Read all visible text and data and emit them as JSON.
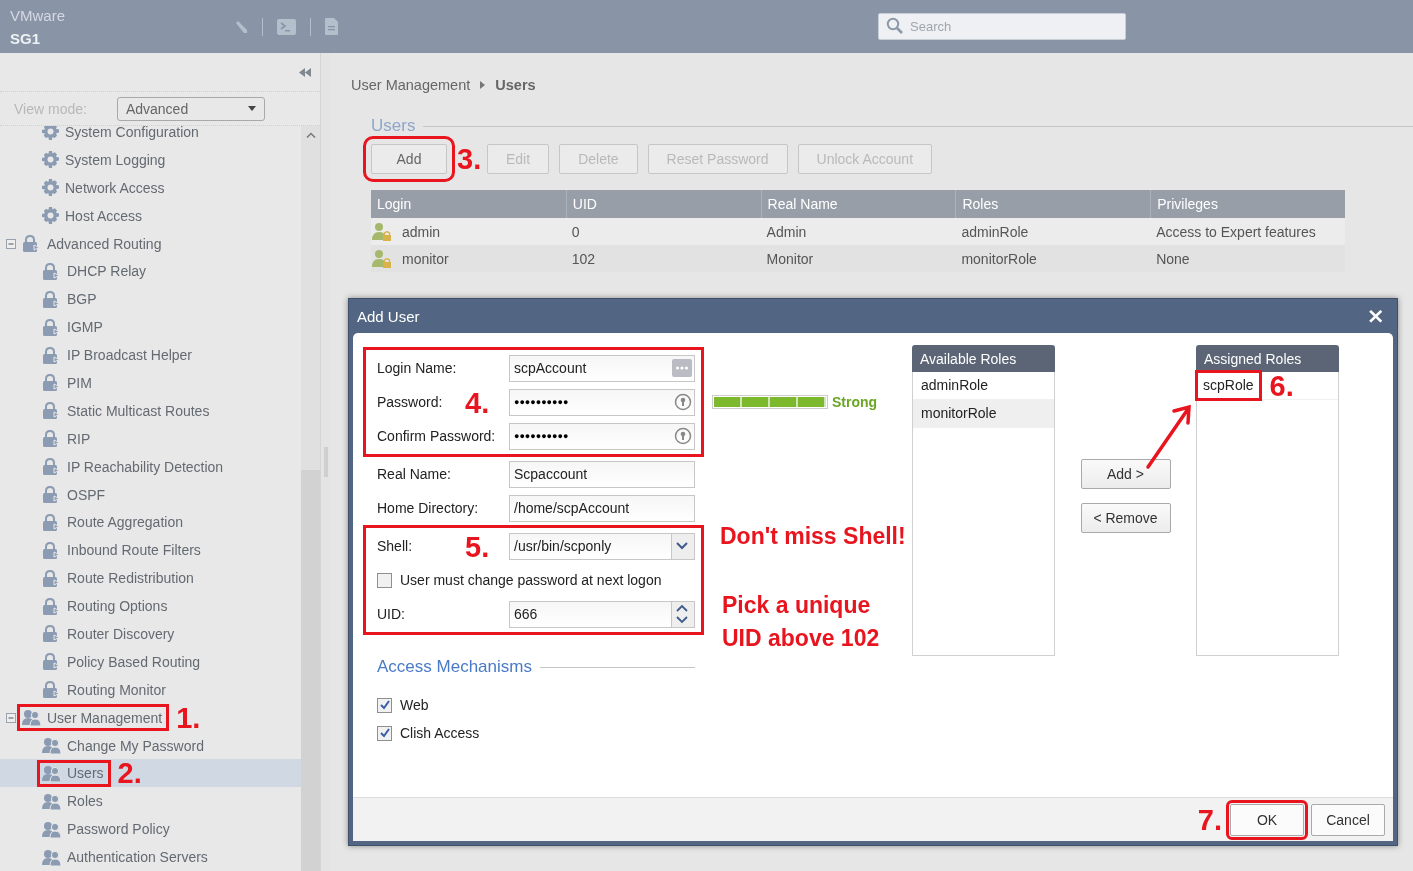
{
  "topbar": {
    "brand": "VMware",
    "host": "SG1",
    "search": {
      "placeholder": "Search"
    }
  },
  "sidebar": {
    "view_mode_label": "View mode:",
    "view_mode": "Advanced",
    "tree": [
      {
        "children": [
          {
            "label": "System Configuration",
            "kind": "gear",
            "selected": false,
            "highlighted": false
          },
          {
            "label": "System Logging",
            "kind": "gear",
            "selected": false,
            "highlighted": false
          },
          {
            "label": "Network Access",
            "kind": "gear",
            "selected": false,
            "highlighted": false
          },
          {
            "label": "Host Access",
            "kind": "gear",
            "selected": false,
            "highlighted": false
          }
        ]
      },
      {
        "label": "Advanced Routing",
        "kind": "routing",
        "expanded": true,
        "selected": false,
        "highlighted": false,
        "children": [
          {
            "label": "DHCP Relay",
            "kind": "routing",
            "selected": false,
            "highlighted": false
          },
          {
            "label": "BGP",
            "kind": "routing",
            "selected": false,
            "highlighted": false
          },
          {
            "label": "IGMP",
            "kind": "routing",
            "selected": false,
            "highlighted": false
          },
          {
            "label": "IP Broadcast Helper",
            "kind": "routing",
            "selected": false,
            "highlighted": false
          },
          {
            "label": "PIM",
            "kind": "routing",
            "selected": false,
            "highlighted": false
          },
          {
            "label": "Static Multicast Routes",
            "kind": "routing",
            "selected": false,
            "highlighted": false
          },
          {
            "label": "RIP",
            "kind": "routing",
            "selected": false,
            "highlighted": false
          },
          {
            "label": "IP Reachability Detection",
            "kind": "routing",
            "selected": false,
            "highlighted": false
          },
          {
            "label": "OSPF",
            "kind": "routing",
            "selected": false,
            "highlighted": false
          },
          {
            "label": "Route Aggregation",
            "kind": "routing",
            "selected": false,
            "highlighted": false
          },
          {
            "label": "Inbound Route Filters",
            "kind": "routing",
            "selected": false,
            "highlighted": false
          },
          {
            "label": "Route Redistribution",
            "kind": "routing",
            "selected": false,
            "highlighted": false
          },
          {
            "label": "Routing Options",
            "kind": "routing",
            "selected": false,
            "highlighted": false
          },
          {
            "label": "Router Discovery",
            "kind": "routing",
            "selected": false,
            "highlighted": false
          },
          {
            "label": "Policy Based Routing",
            "kind": "routing",
            "selected": false,
            "highlighted": false
          },
          {
            "label": "Routing Monitor",
            "kind": "routing",
            "selected": false,
            "highlighted": false
          }
        ]
      },
      {
        "label": "User Management",
        "kind": "user",
        "expanded": true,
        "selected": false,
        "highlighted": true,
        "step": "1.",
        "children": [
          {
            "label": "Change My Password",
            "kind": "user",
            "selected": false,
            "highlighted": false
          },
          {
            "label": "Users",
            "kind": "user",
            "selected": true,
            "highlighted": true,
            "step": "2."
          },
          {
            "label": "Roles",
            "kind": "user",
            "selected": false,
            "highlighted": false
          },
          {
            "label": "Password Policy",
            "kind": "user",
            "selected": false,
            "highlighted": false
          },
          {
            "label": "Authentication Servers",
            "kind": "user",
            "selected": false,
            "highlighted": false
          }
        ]
      }
    ]
  },
  "breadcrumb": [
    "User Management",
    "Users"
  ],
  "section_title": "Users",
  "toolbar": [
    {
      "label": "Add",
      "disabled": false,
      "highlighted": true,
      "step": "3."
    },
    {
      "label": "Edit",
      "disabled": true,
      "highlighted": false
    },
    {
      "label": "Delete",
      "disabled": true,
      "highlighted": false
    },
    {
      "label": "Reset Password",
      "disabled": true,
      "highlighted": false
    },
    {
      "label": "Unlock Account",
      "disabled": true,
      "highlighted": false
    }
  ],
  "table": {
    "columns": [
      "Login",
      "UID",
      "Real Name",
      "Roles",
      "Privileges"
    ],
    "rows": [
      {
        "login": "admin",
        "uid": "0",
        "real_name": "Admin",
        "roles": "adminRole",
        "privileges": "Access to Expert features"
      },
      {
        "login": "monitor",
        "uid": "102",
        "real_name": "Monitor",
        "roles": "monitorRole",
        "privileges": "None"
      }
    ]
  },
  "dialog": {
    "title": "Add User",
    "close": "×",
    "groups": [
      {
        "highlighted": true,
        "fields": [
          {
            "label": "Login Name:",
            "kind": "text-button",
            "value": "scpAccount"
          },
          {
            "label": "Password:",
            "kind": "password",
            "value": "●●●●●●●●●●",
            "step": "4.",
            "meter": {
              "level": 1,
              "label": "Strong"
            }
          },
          {
            "label": "Confirm Password:",
            "kind": "password",
            "value": "●●●●●●●●●●"
          }
        ]
      },
      {
        "highlighted": false,
        "fields": [
          {
            "label": "Real Name:",
            "kind": "text",
            "value": "Scpaccount"
          },
          {
            "label": "Home Directory:",
            "kind": "text",
            "value": "/home/scpAccount"
          }
        ]
      },
      {
        "highlighted": true,
        "fields": [
          {
            "label": "Shell:",
            "kind": "select",
            "value": "/usr/bin/scponly",
            "step": "5."
          },
          {
            "label": "User must change password at next logon",
            "kind": "checkbox",
            "checked": false
          },
          {
            "label": "UID:",
            "kind": "spinner",
            "value": "666"
          }
        ]
      }
    ],
    "access": {
      "title": "Access Mechanisms",
      "items": [
        {
          "label": "Web",
          "checked": true
        },
        {
          "label": "Clish Access",
          "checked": true
        }
      ]
    },
    "notes": [
      "Don't miss Shell!",
      "Pick a unique UID above 102"
    ],
    "available_roles": {
      "title": "Available Roles",
      "items": [
        {
          "label": "adminRole",
          "selected": false
        },
        {
          "label": "monitorRole",
          "selected": true
        }
      ]
    },
    "move_buttons": [
      "Add >",
      "< Remove"
    ],
    "assigned_roles": {
      "title": "Assigned Roles",
      "items": [
        {
          "label": "scpRole",
          "selected": false,
          "highlighted": true,
          "step": "6."
        }
      ]
    },
    "footer": [
      {
        "label": "OK",
        "highlighted": true,
        "step": "7."
      },
      {
        "label": "Cancel",
        "highlighted": false
      }
    ]
  }
}
